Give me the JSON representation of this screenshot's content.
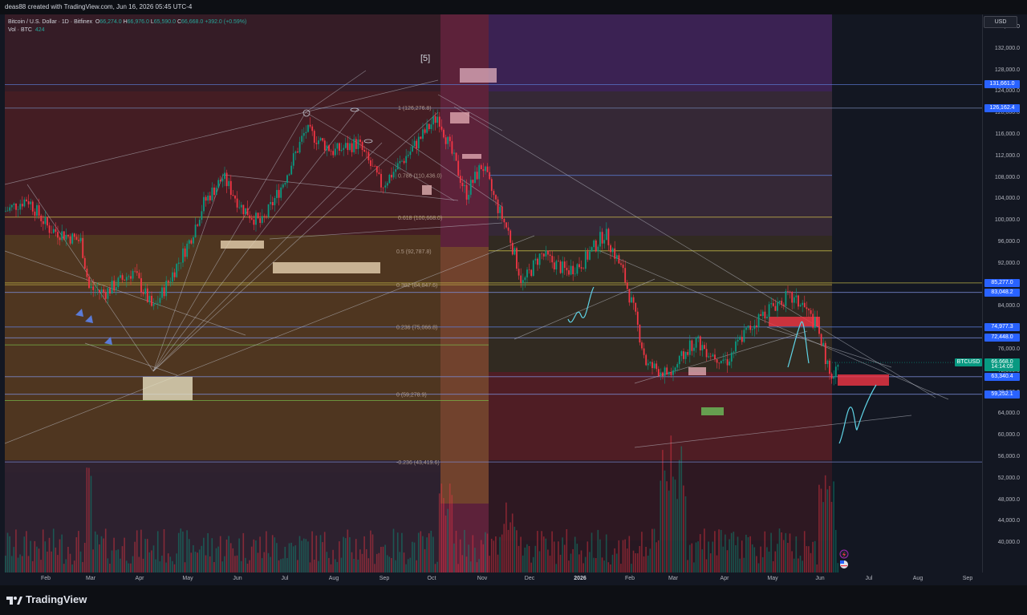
{
  "header": {
    "author_line": "deas88 created with TradingView.com, Jun 16, 2026 05:45 UTC-4"
  },
  "legend": {
    "symbol": "Bitcoin / U.S. Dollar · 1D · Bitfinex",
    "o_label": "O",
    "o_val": "66,274.0",
    "h_label": "H",
    "h_val": "66,976.0",
    "l_label": "L",
    "l_val": "65,590.0",
    "c_label": "C",
    "c_val": "66,668.0",
    "change": "+392.0 (+0.59%)",
    "vol_label": "Vol · BTC",
    "vol_val": "424"
  },
  "currency_button": "USD",
  "wave_label": "[5]",
  "price_scale": [
    "136,000.0",
    "132,000.0",
    "128,000.0",
    "124,000.0",
    "120,000.0",
    "116,000.0",
    "112,000.0",
    "108,000.0",
    "104,000.0",
    "100,000.0",
    "96,000.0",
    "92,000.0",
    "88,000.0",
    "84,000.0",
    "80,000.0",
    "76,000.0",
    "72,000.0",
    "68,000.0",
    "64,000.0",
    "60,000.0",
    "56,000.0",
    "52,000.0",
    "48,000.0",
    "44,000.0",
    "40,000.0"
  ],
  "price_badges": [
    {
      "label": "131,661.0",
      "price": 131661,
      "color": "#2962ff"
    },
    {
      "label": "126,162.4",
      "price": 126162,
      "color": "#2962ff"
    },
    {
      "label": "85,277.0",
      "price": 85277,
      "color": "#2962ff"
    },
    {
      "label": "83,048.2",
      "price": 83048,
      "color": "#2962ff"
    },
    {
      "label": "74,977.3",
      "price": 74977,
      "color": "#2962ff"
    },
    {
      "label": "72,448.0",
      "price": 72448,
      "color": "#2962ff"
    },
    {
      "label": "66,668.0",
      "price": 66668,
      "color": "#089981"
    },
    {
      "label": "14:14:05",
      "price": 65600,
      "color": "#089981"
    },
    {
      "label": "63,340.4",
      "price": 63340,
      "color": "#2962ff"
    },
    {
      "label": "59,252.1",
      "price": 59252,
      "color": "#2962ff"
    }
  ],
  "ticker_tag": "BTCUSD",
  "fib_labels": [
    {
      "text": "1 (126,276.8)",
      "price": 126276
    },
    {
      "text": "0.786 (110,436.0)",
      "price": 110436
    },
    {
      "text": "0.618 (100,668.0)",
      "price": 100668
    },
    {
      "text": "0.5 (92,787.8)",
      "price": 92787
    },
    {
      "text": "0.382 (84,847.6)",
      "price": 84847
    },
    {
      "text": "0.236 (75,066.8)",
      "price": 75066
    },
    {
      "text": "0 (59,278.9)",
      "price": 59278
    },
    {
      "text": "-0.236 (43,419.6)",
      "price": 43419
    }
  ],
  "time_axis": [
    {
      "label": "Feb",
      "bold": false
    },
    {
      "label": "Mar",
      "bold": false
    },
    {
      "label": "Apr",
      "bold": false
    },
    {
      "label": "May",
      "bold": false
    },
    {
      "label": "Jun",
      "bold": false
    },
    {
      "label": "Jul",
      "bold": false
    },
    {
      "label": "Aug",
      "bold": false
    },
    {
      "label": "Sep",
      "bold": false
    },
    {
      "label": "Oct",
      "bold": false
    },
    {
      "label": "Nov",
      "bold": false
    },
    {
      "label": "Dec",
      "bold": false
    },
    {
      "label": "2026",
      "bold": true
    },
    {
      "label": "Feb",
      "bold": false
    },
    {
      "label": "Mar",
      "bold": false
    },
    {
      "label": "Apr",
      "bold": false
    },
    {
      "label": "May",
      "bold": false
    },
    {
      "label": "Jun",
      "bold": false
    },
    {
      "label": "Jul",
      "bold": false
    },
    {
      "label": "Aug",
      "bold": false
    },
    {
      "label": "Sep",
      "bold": false
    }
  ],
  "footer": {
    "brand": "TradingView"
  },
  "colors": {
    "bg": "#131722",
    "up": "#089981",
    "down": "#f23645",
    "accent": "#2962ff"
  },
  "icons": {
    "logo": "tradingview-logo-icon",
    "events": "lightning-event-icon",
    "flag": "us-flag-icon"
  }
}
